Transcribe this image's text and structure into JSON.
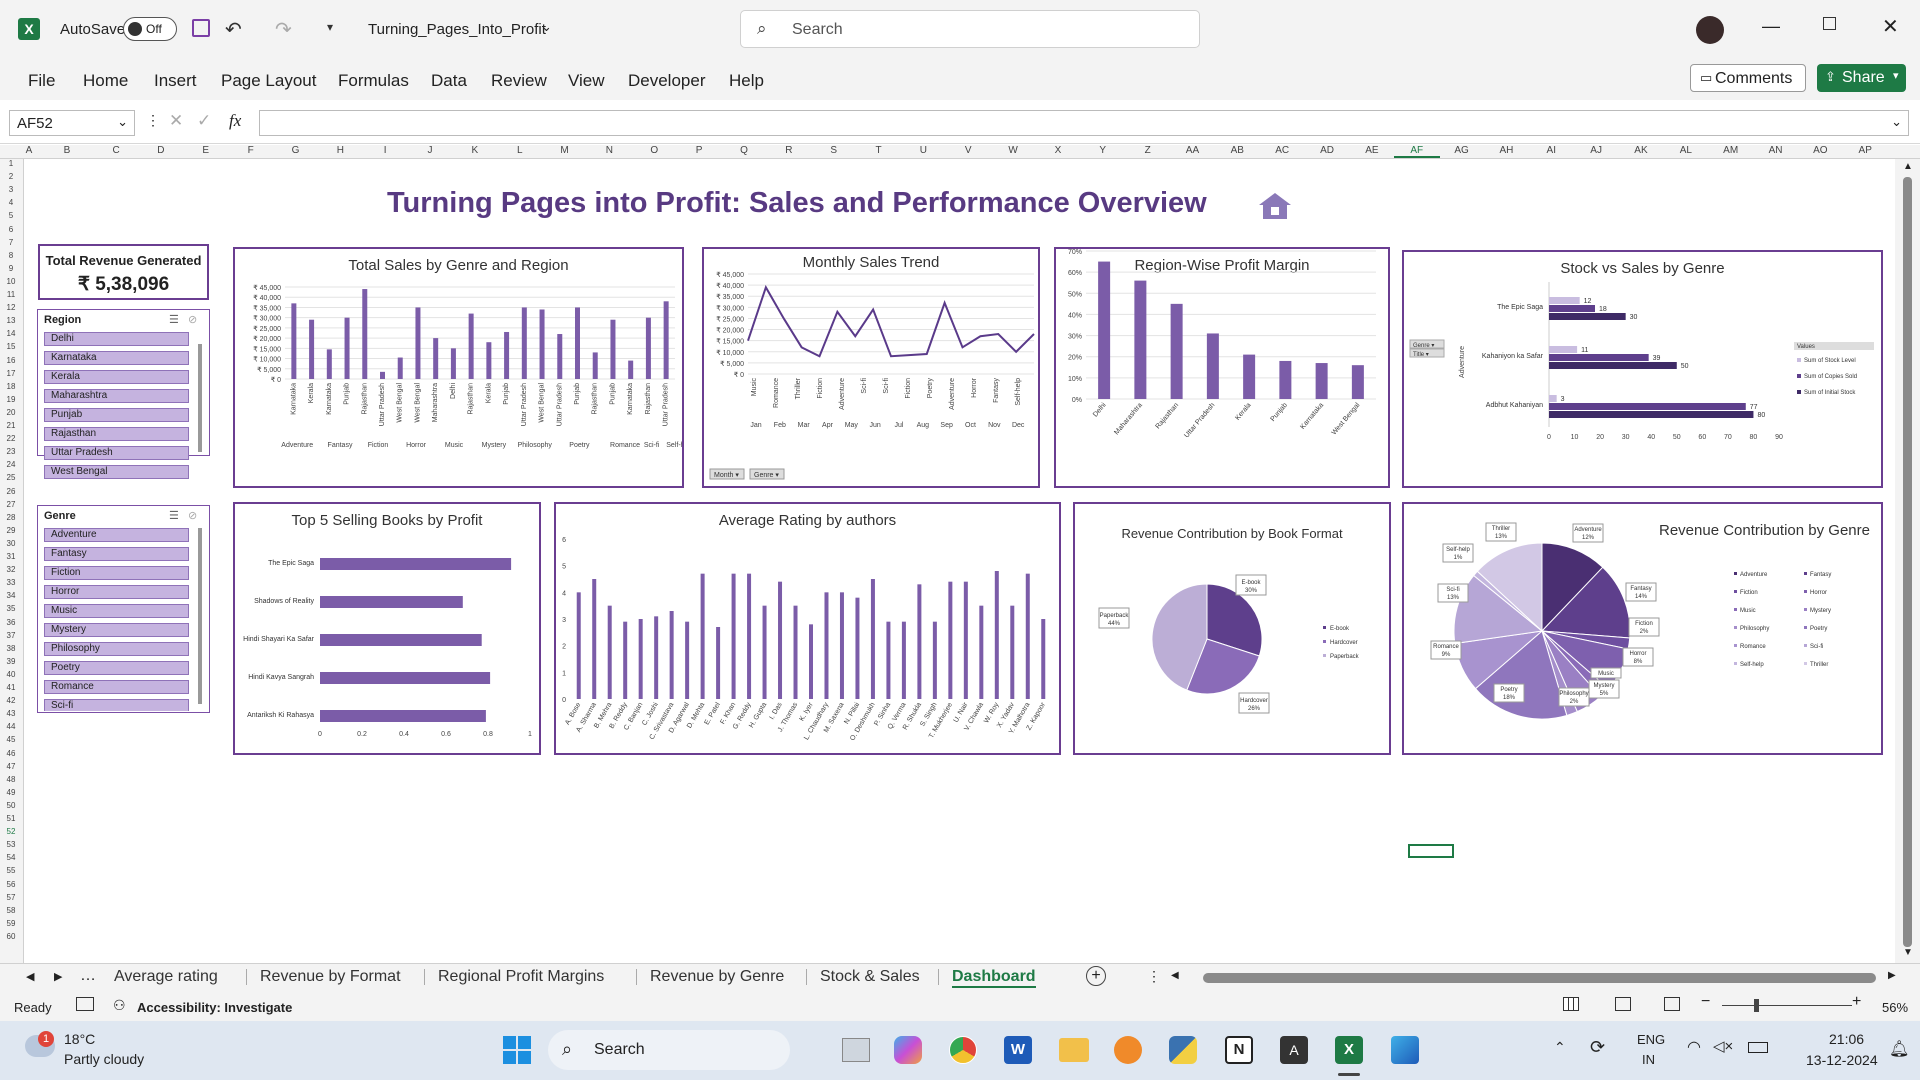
{
  "app": {
    "autosave_label": "AutoSave",
    "autosave_state": "Off",
    "file_name": "Turning_Pages_Into_Profit",
    "search_placeholder": "Search",
    "comments": "Comments",
    "share": "Share"
  },
  "menu": [
    "File",
    "Home",
    "Insert",
    "Page Layout",
    "Formulas",
    "Data",
    "Review",
    "View",
    "Developer",
    "Help"
  ],
  "formula_bar": {
    "name_box": "AF52",
    "fx": "fx",
    "value": ""
  },
  "columns": [
    "A",
    "B",
    "C",
    "D",
    "E",
    "F",
    "G",
    "H",
    "I",
    "J",
    "K",
    "L",
    "M",
    "N",
    "O",
    "P",
    "Q",
    "R",
    "S",
    "T",
    "U",
    "V",
    "W",
    "X",
    "Y",
    "Z",
    "AA",
    "AB",
    "AC",
    "AD",
    "AE",
    "AF",
    "AG",
    "AH",
    "AI",
    "AJ",
    "AK",
    "AL",
    "AM",
    "AN",
    "AO",
    "AP"
  ],
  "dashboard": {
    "title": "Turning Pages into Profit: Sales and Performance Overview"
  },
  "kpi": {
    "label": "Total Revenue Generated",
    "value": "₹ 5,38,096"
  },
  "region_slicer": {
    "title": "Region",
    "items": [
      "Delhi",
      "Karnataka",
      "Kerala",
      "Maharashtra",
      "Punjab",
      "Rajasthan",
      "Uttar Pradesh",
      "West Bengal"
    ]
  },
  "genre_slicer": {
    "title": "Genre",
    "items": [
      "Adventure",
      "Fantasy",
      "Fiction",
      "Horror",
      "Music",
      "Mystery",
      "Philosophy",
      "Poetry",
      "Romance",
      "Sci-fi",
      "Self-help",
      "Thriller"
    ]
  },
  "chart_data": [
    {
      "type": "bar",
      "title": "Total Sales by Genre and Region",
      "ylim": [
        0,
        45000
      ],
      "yticks": [
        "₹ 0",
        "₹ 5,000",
        "₹ 10,000",
        "₹ 15,000",
        "₹ 20,000",
        "₹ 25,000",
        "₹ 30,000",
        "₹ 35,000",
        "₹ 40,000",
        "₹ 45,000"
      ],
      "categories": [
        "Karnataka",
        "Kerala",
        "Karnataka",
        "Punjab",
        "Rajasthan",
        "Uttar Pradesh",
        "West Bengal",
        "West Bengal",
        "Maharashtra",
        "Delhi",
        "Rajasthan",
        "Kerala",
        "Punjab",
        "Uttar Pradesh",
        "West Bengal",
        "Uttar Pradesh",
        "Punjab",
        "Rajasthan",
        "Punjab",
        "Karnataka",
        "Rajasthan",
        "Uttar Pradesh"
      ],
      "values": [
        37000,
        29000,
        14500,
        30000,
        44000,
        3500,
        10500,
        35000,
        20000,
        15000,
        32000,
        18000,
        23000,
        35000,
        34000,
        22000,
        35000,
        13000,
        29000,
        9000,
        30000,
        38000
      ],
      "groups": [
        "Adventure",
        "Fantasy",
        "Fiction",
        "Horror",
        "Music",
        "Mystery",
        "Philosophy",
        "Poetry",
        "Romance",
        "Sci-fi",
        "Self-help",
        "Thriller"
      ]
    },
    {
      "type": "line",
      "title": "Monthly Sales Trend",
      "ylim": [
        0,
        45000
      ],
      "yticks": [
        "₹ 0",
        "₹ 5,000",
        "₹ 10,000",
        "₹ 15,000",
        "₹ 20,000",
        "₹ 25,000",
        "₹ 30,000",
        "₹ 35,000",
        "₹ 40,000",
        "₹ 45,000"
      ],
      "categories": [
        "Music",
        "Romance",
        "Thriller",
        "Fiction",
        "Adventure",
        "Sci-fi",
        "Sci-fi",
        "Fiction",
        "Poetry",
        "Adventure",
        "Horror",
        "Fantasy",
        "Self-help"
      ],
      "months": [
        "Jan",
        "Feb",
        "Mar",
        "Apr",
        "May",
        "Jun",
        "Jul",
        "Aug",
        "Sep",
        "Oct",
        "Nov",
        "Dec"
      ],
      "values": [
        15000,
        39000,
        25000,
        12000,
        8000,
        28000,
        17000,
        29000,
        8000,
        8500,
        9000,
        32000,
        12000,
        17000,
        18000,
        10000,
        18000
      ],
      "filters": [
        "Month",
        "Genre"
      ]
    },
    {
      "type": "bar",
      "title": "Region-Wise Profit Margin",
      "ylim": [
        0,
        70
      ],
      "yticks": [
        "0%",
        "10%",
        "20%",
        "30%",
        "40%",
        "50%",
        "60%",
        "70%"
      ],
      "categories": [
        "Delhi",
        "Maharashtra",
        "Rajasthan",
        "Uttar Pradesh",
        "Kerala",
        "Punjab",
        "Karnataka",
        "West Bengal"
      ],
      "values": [
        65,
        56,
        45,
        31,
        21,
        18,
        17,
        16
      ]
    },
    {
      "type": "bar",
      "title": "Stock vs Sales by Genre",
      "xlim": [
        0,
        90
      ],
      "xticks": [
        "0",
        "10",
        "20",
        "30",
        "40",
        "50",
        "60",
        "70",
        "80",
        "90"
      ],
      "axis_label": "Adventure",
      "categories": [
        "The Epic Saga",
        "Kahaniyon ka Safar",
        "Adbhut Kahaniyan"
      ],
      "series": [
        {
          "name": "Sum of Stock Level",
          "values": [
            12,
            11,
            3
          ]
        },
        {
          "name": "Sum of Copies Sold",
          "values": [
            18,
            39,
            77
          ]
        },
        {
          "name": "Sum of Initial Stock",
          "values": [
            30,
            50,
            80
          ]
        }
      ],
      "legend_title": "Values",
      "filters": [
        "Genre",
        "Title"
      ]
    },
    {
      "type": "bar",
      "title": "Top 5 Selling Books by Profit",
      "xlim": [
        0,
        1
      ],
      "xticks": [
        "0",
        "0.2",
        "0.4",
        "0.6",
        "0.8",
        "1"
      ],
      "categories": [
        "The Epic Saga",
        "Shadows of Reality",
        "Hindi Shayari Ka Safar",
        "Hindi Kavya Sangrah",
        "Antariksh Ki Rahasya"
      ],
      "values": [
        0.91,
        0.68,
        0.77,
        0.81,
        0.79
      ]
    },
    {
      "type": "bar",
      "title": "Average Rating by authors",
      "ylim": [
        0,
        6
      ],
      "yticks": [
        "0",
        "1",
        "2",
        "3",
        "4",
        "5",
        "6"
      ],
      "categories": [
        "A. Bose",
        "A. Sharma",
        "B. Mehra",
        "B. Reddy",
        "C. Banjan",
        "C. Joshi",
        "C. Srivastava",
        "D. Agarwal",
        "D. Mehta",
        "E. Patel",
        "F. Khan",
        "G. Reddy",
        "H. Gupta",
        "I. Das",
        "J. Thomas",
        "K. Iyer",
        "L. Chaudhary",
        "M. Saxena",
        "N. Pillai",
        "O. Deshmukh",
        "P. Sinha",
        "Q. Verma",
        "R. Shukla",
        "S. Singh",
        "T. Mukherjee",
        "U. Nair",
        "V. Chawla",
        "W. Roy",
        "X. Yadav",
        "Y. Malhotra",
        "Z. Kapoor"
      ],
      "values": [
        4,
        4.5,
        3.5,
        2.9,
        3,
        3.1,
        3.3,
        2.9,
        4.7,
        2.7,
        4.7,
        4.7,
        3.5,
        4.4,
        3.5,
        2.8,
        4,
        4,
        3.8,
        4.5,
        2.9,
        2.9,
        4.3,
        2.9,
        4.4,
        4.4,
        3.5,
        4.8,
        3.5,
        4.7,
        3
      ]
    },
    {
      "type": "pie",
      "title": "Revenue Contribution by Book Format",
      "categories": [
        "E-book",
        "Hardcover",
        "Paperback"
      ],
      "values": [
        30,
        26,
        44
      ],
      "labels": [
        "E-book\n30%",
        "Hardcover\n26%",
        "Paperback\n44%"
      ]
    },
    {
      "type": "pie",
      "title": "Revenue Contribution by Genre",
      "categories": [
        "Adventure",
        "Fantasy",
        "Fiction",
        "Horror",
        "Music",
        "Mystery",
        "Philosophy",
        "Poetry",
        "Romance",
        "Sci-fi",
        "Self-help",
        "Thriller"
      ],
      "values": [
        12,
        14,
        2,
        8,
        2,
        5,
        2,
        18,
        9,
        13,
        1,
        13
      ],
      "labels": [
        "Adventure 12%",
        "Fantasy 14%",
        "Fiction 2%",
        "Horror 8%",
        "Music",
        "Mystery 5%",
        "Philosophy 2%",
        "Poetry 18%",
        "Romance 9%",
        "Sci-fi 13%",
        "Self-help 1%",
        "Thriller 13%"
      ]
    }
  ],
  "sheet_tabs": [
    "Average rating",
    "Revenue by Format",
    "Regional Profit Margins",
    "Revenue by Genre",
    "Stock & Sales",
    "Dashboard"
  ],
  "active_tab": "Dashboard",
  "status": {
    "ready": "Ready",
    "accessibility": "Accessibility: Investigate",
    "zoom": "56%"
  },
  "taskbar": {
    "temp": "18°C",
    "weather": "Partly cloudy",
    "search": "Search",
    "lang1": "ENG",
    "lang2": "IN",
    "time": "21:06",
    "date": "13-12-2024"
  },
  "colors": {
    "accent": "#6a3d91",
    "bar": "#7b5ca8",
    "excel_green": "#1e7a45"
  }
}
